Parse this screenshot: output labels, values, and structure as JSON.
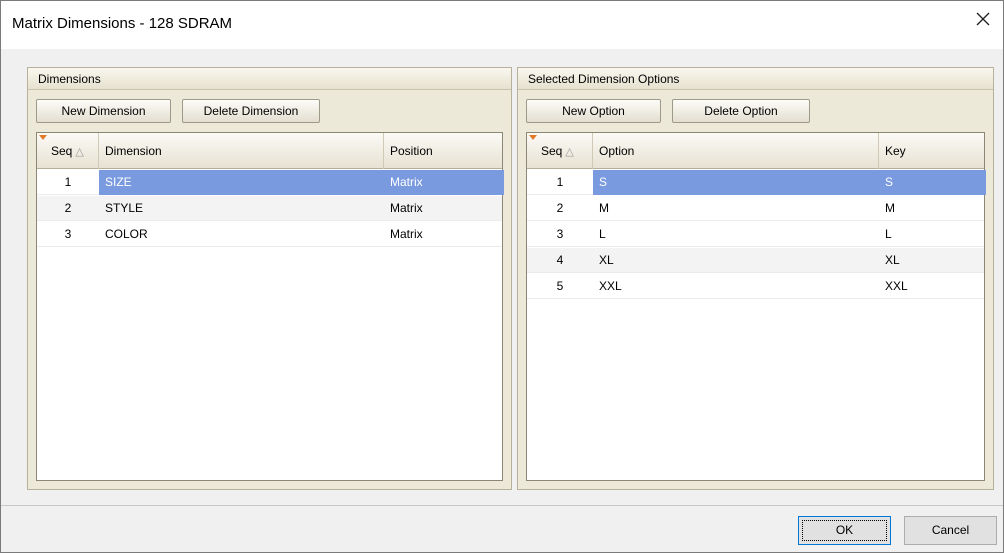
{
  "window": {
    "title": "Matrix Dimensions - 128 SDRAM",
    "close_glyph": "✕"
  },
  "dimensions_panel": {
    "header": "Dimensions",
    "new_button": "New Dimension",
    "delete_button": "Delete Dimension",
    "columns": [
      "Seq",
      "Dimension",
      "Position"
    ],
    "sort_glyph": "△",
    "rows": [
      {
        "seq": "1",
        "dimension": "SIZE",
        "position": "Matrix",
        "selected": true
      },
      {
        "seq": "2",
        "dimension": "STYLE",
        "position": "Matrix",
        "selected": false
      },
      {
        "seq": "3",
        "dimension": "COLOR",
        "position": "Matrix",
        "selected": false
      }
    ]
  },
  "options_panel": {
    "header": "Selected Dimension Options",
    "new_button": "New Option",
    "delete_button": "Delete Option",
    "columns": [
      "Seq",
      "Option",
      "Key"
    ],
    "sort_glyph": "△",
    "rows": [
      {
        "seq": "1",
        "option": "S",
        "key": "S",
        "selected": true
      },
      {
        "seq": "2",
        "option": "M",
        "key": "M",
        "selected": false
      },
      {
        "seq": "3",
        "option": "L",
        "key": "L",
        "selected": false
      },
      {
        "seq": "4",
        "option": "XL",
        "key": "XL",
        "selected": false
      },
      {
        "seq": "5",
        "option": "XXL",
        "key": "XXL",
        "selected": false
      }
    ]
  },
  "footer": {
    "ok_label": "OK",
    "cancel_label": "Cancel"
  },
  "colors": {
    "selection": "#7a9ae0",
    "panel_bg": "#ece9d8",
    "sort_indicator": "#e07a2a"
  }
}
